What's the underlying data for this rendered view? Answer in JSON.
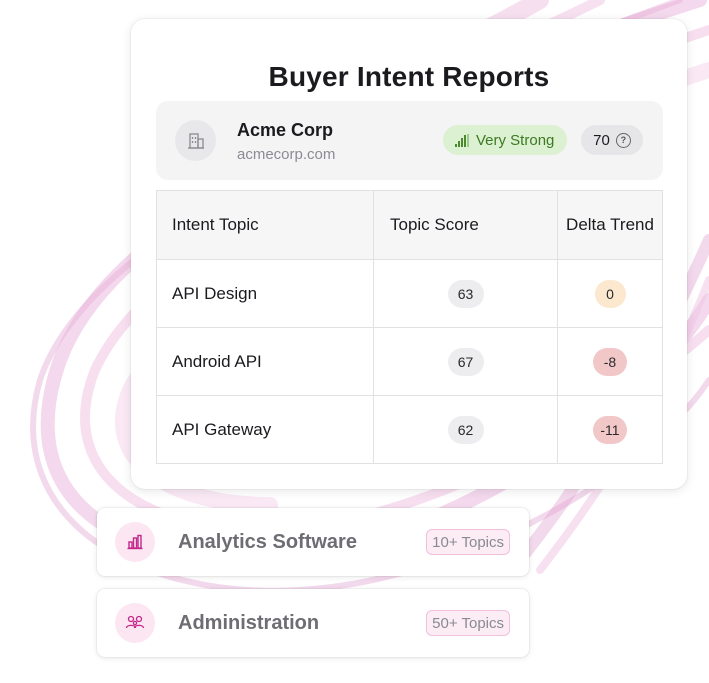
{
  "report": {
    "title": "Buyer Intent Reports",
    "company": {
      "icon": "building-icon",
      "name": "Acme Corp",
      "domain": "acmecorp.com",
      "intent_strength": "Very Strong",
      "intent_strength_icon": "signal-bars-icon",
      "intent_score": "70",
      "help_icon": "question-circle-icon"
    },
    "table": {
      "headers": [
        "Intent Topic",
        "Topic Score",
        "Delta Trend"
      ],
      "rows": [
        {
          "topic": "API Design",
          "score": "63",
          "delta": "0"
        },
        {
          "topic": "Android API",
          "score": "67",
          "delta": "-8"
        },
        {
          "topic": "API Gateway",
          "score": "62",
          "delta": "-11"
        }
      ]
    }
  },
  "categories": [
    {
      "icon": "bar-chart-icon",
      "label": "Analytics Software",
      "badge": "10+ Topics"
    },
    {
      "icon": "users-group-icon",
      "label": "Administration",
      "badge": "50+ Topics"
    }
  ],
  "colors": {
    "accent_pink": "#c2288a",
    "strength_bg": "#dcf0d2",
    "strength_text": "#3d7a23",
    "delta_neutral": "#fbe8cf",
    "delta_negative": "#f1c7c7"
  }
}
